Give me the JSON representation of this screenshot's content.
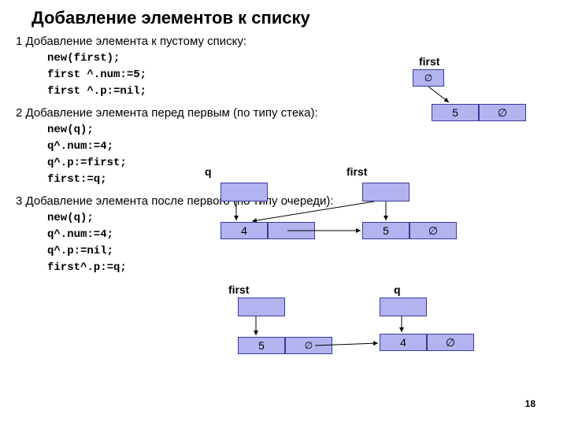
{
  "title": "Добавление элементов к списку",
  "sec1": {
    "caption": "1 Добавление элемента к пустому списку:",
    "code": {
      "l1": "new(first);",
      "l2": "first ^.num:=5;",
      "l3": "first ^.p:=nil;"
    },
    "label_first": "first",
    "node_val": "5",
    "node_nil": "∅"
  },
  "sec2": {
    "caption": "2 Добавление элемента перед первым (по типу стека):",
    "code": {
      "l1": "new(q);",
      "l2": "q^.num:=4;",
      "l3": "q^.p:=first;",
      "l4": "first:=q;"
    },
    "label_q": "q",
    "label_first": "first",
    "node_a_val": "4",
    "node_b_val": "5",
    "node_b_nil": "∅"
  },
  "sec3": {
    "caption": "3 Добавление элемента после первого (по типу очереди):",
    "code": {
      "l1": "new(q);",
      "l2": "q^.num:=4;",
      "l3": "q^.p:=nil;",
      "l4": "first^.p:=q;"
    },
    "label_first": "first",
    "label_q": "q",
    "node_a_val": "5",
    "node_a_nil": "∅",
    "node_b_val": "4",
    "node_b_nil": "∅"
  },
  "pagenum": "18"
}
